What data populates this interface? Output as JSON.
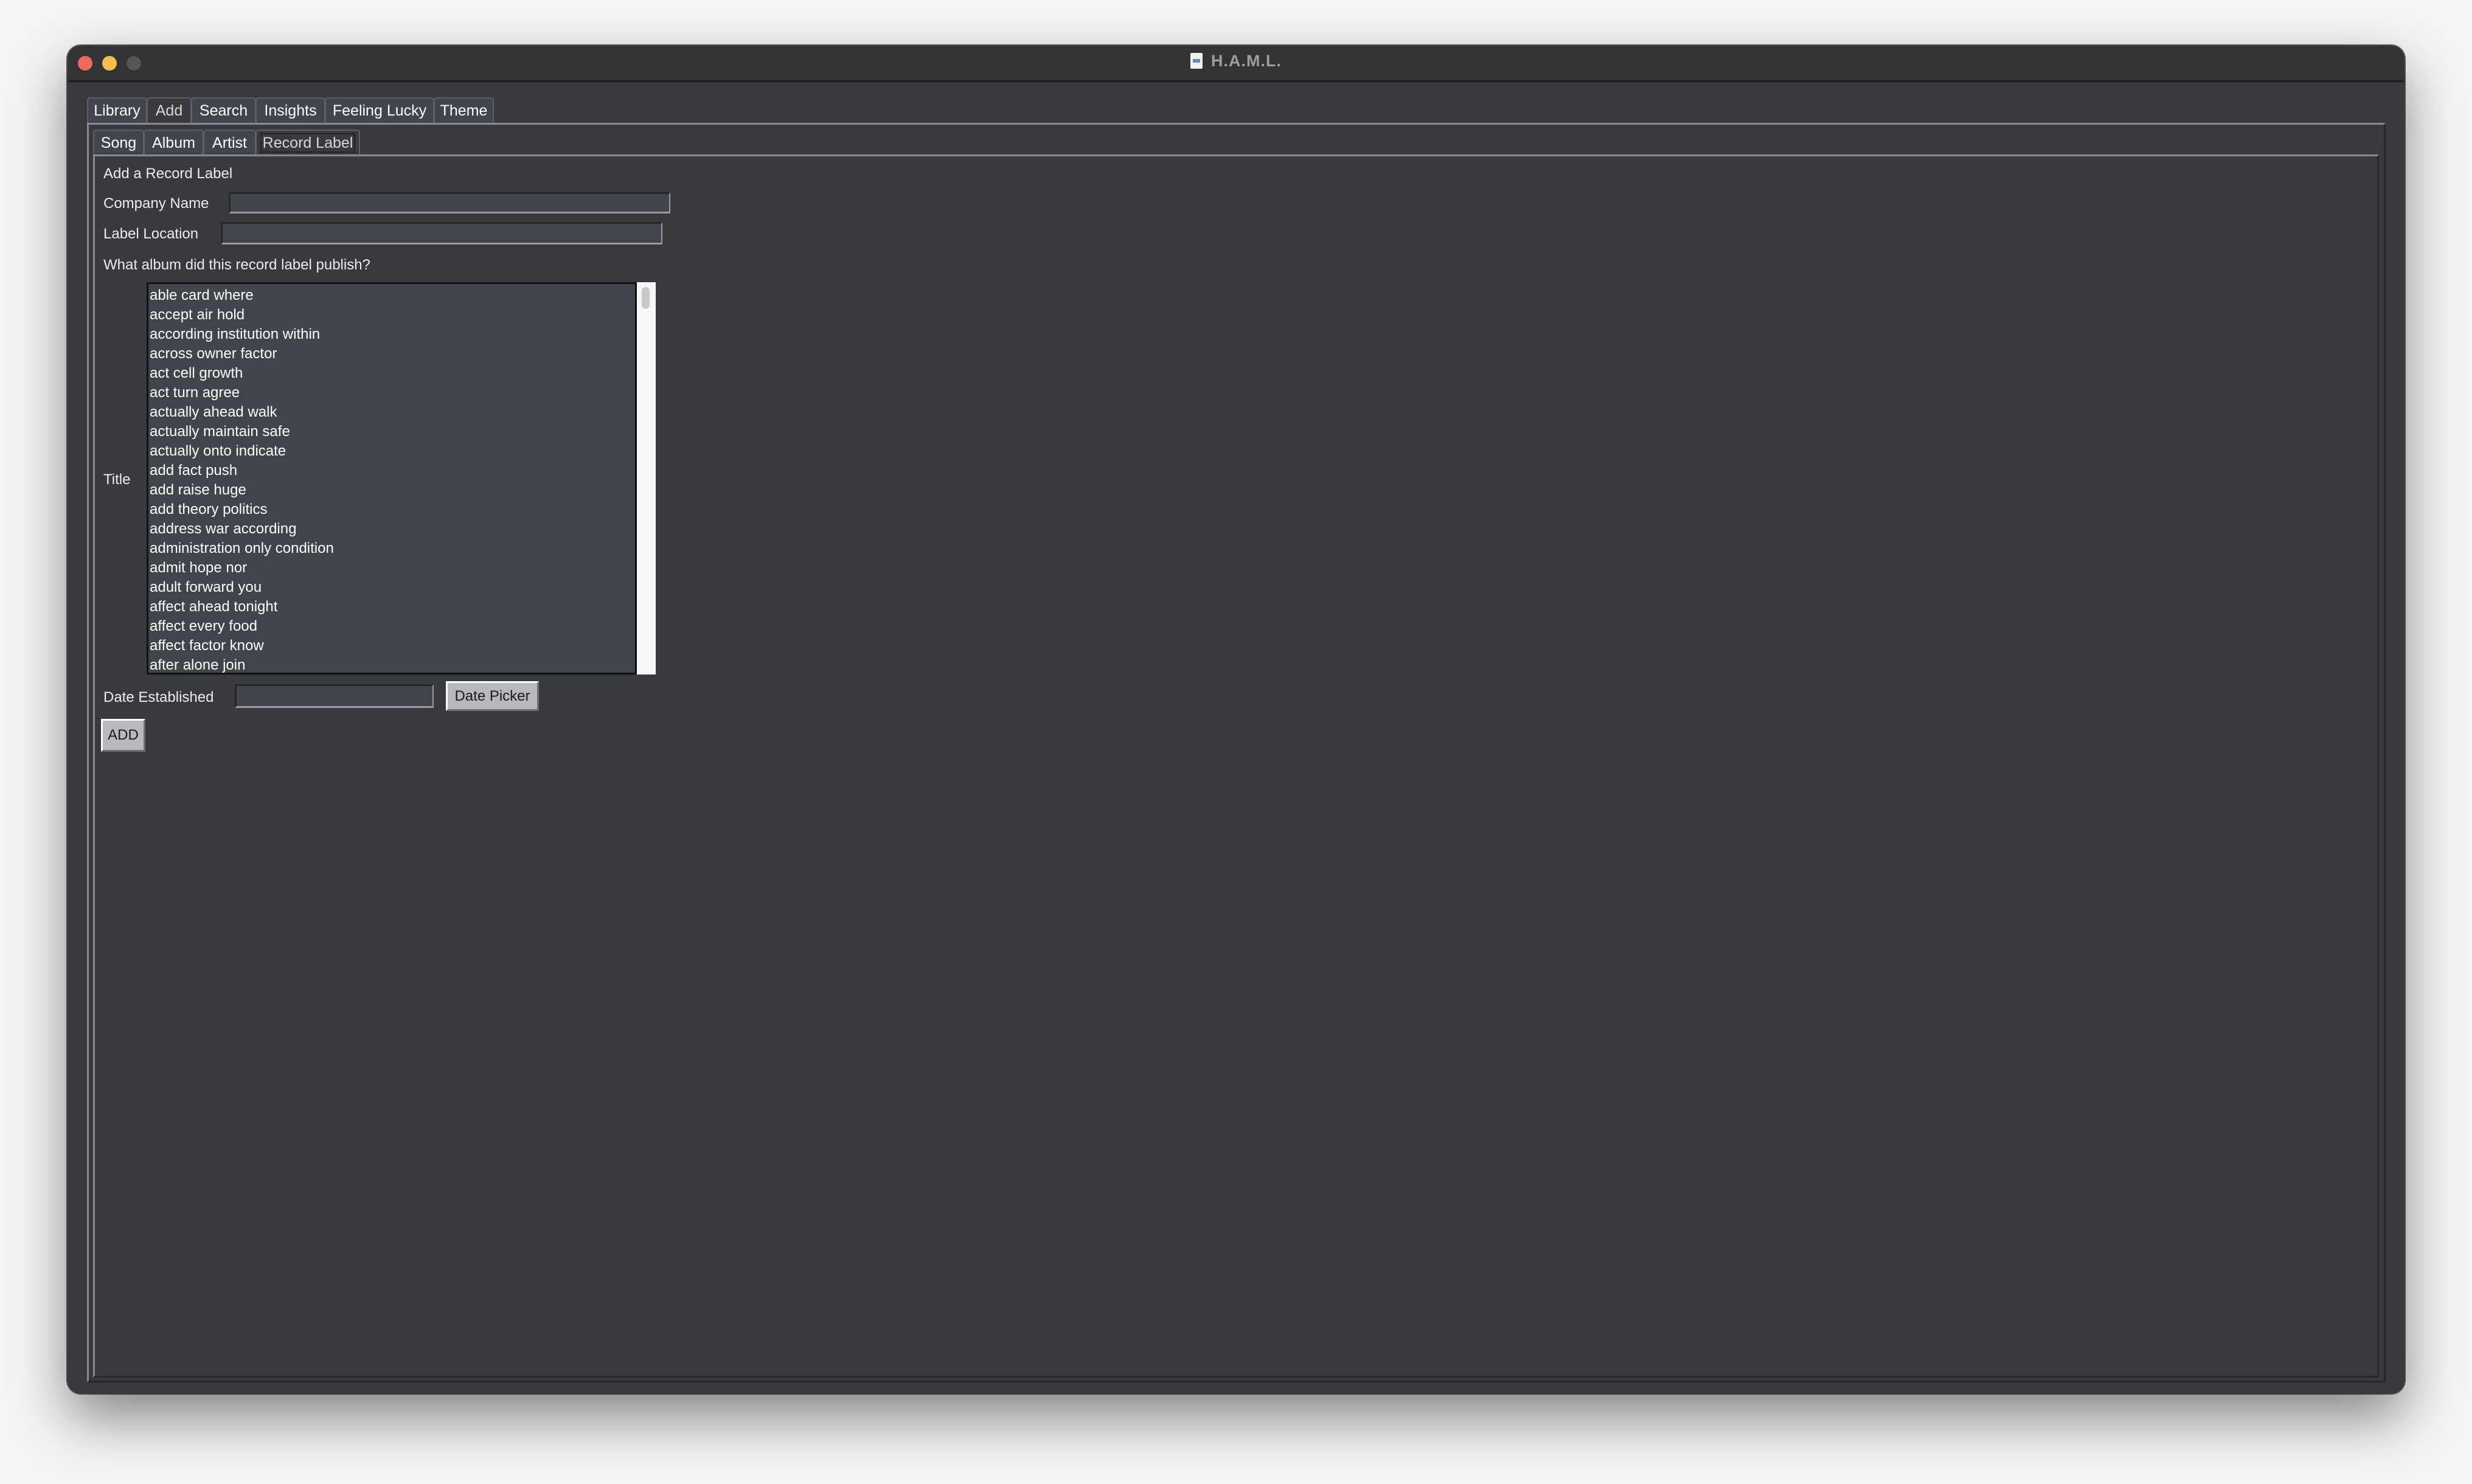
{
  "window": {
    "title": "H.A.M.L.",
    "title_icon": "document-icon"
  },
  "main_tabs": [
    {
      "label": "Library",
      "selected": false
    },
    {
      "label": "Add",
      "selected": true
    },
    {
      "label": "Search",
      "selected": false
    },
    {
      "label": "Insights",
      "selected": false
    },
    {
      "label": "Feeling Lucky",
      "selected": false
    },
    {
      "label": "Theme",
      "selected": false
    }
  ],
  "sub_tabs": [
    {
      "label": "Song",
      "selected": false
    },
    {
      "label": "Album",
      "selected": false
    },
    {
      "label": "Artist",
      "selected": false
    },
    {
      "label": "Record Label",
      "selected": true
    }
  ],
  "form": {
    "heading": "Add a Record Label",
    "company_name_label": "Company Name",
    "company_name_value": "",
    "label_location_label": "Label Location",
    "label_location_value": "",
    "album_question": "What album did this record label publish?",
    "title_label": "Title",
    "albums": [
      "able card where",
      "accept air hold",
      "according institution within",
      "across owner factor",
      "act cell growth",
      "act turn agree",
      "actually ahead walk",
      "actually maintain safe",
      "actually onto indicate",
      "add fact push",
      "add raise huge",
      "add theory politics",
      "address war according",
      "administration only condition",
      "admit hope nor",
      "adult forward you",
      "affect ahead tonight",
      "affect every food",
      "affect factor know",
      "after alone join"
    ],
    "date_established_label": "Date Established",
    "date_established_value": "",
    "date_picker_button": "Date Picker",
    "add_button": "ADD"
  }
}
